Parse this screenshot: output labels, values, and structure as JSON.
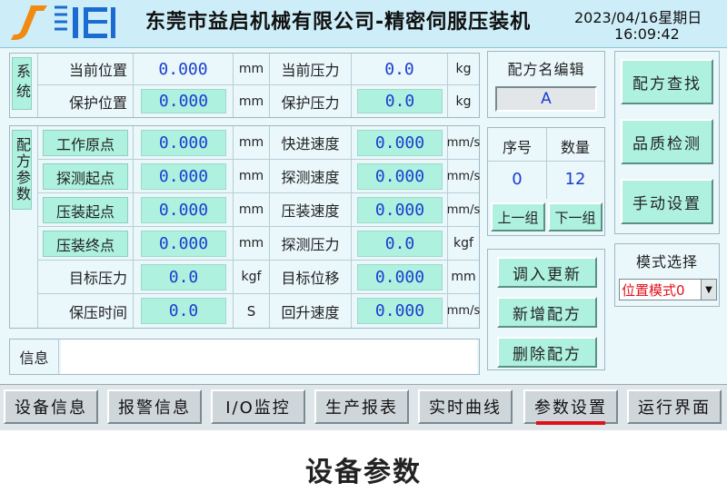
{
  "header": {
    "company": "东莞市益启机械有限公司-精密伺服压装机",
    "date": "2023/04/16星期日",
    "time": "16:09:42"
  },
  "system": {
    "label": "系统",
    "rows": [
      {
        "label": "当前位置",
        "value": "0.000",
        "unit": "mm",
        "label2": "当前压力",
        "value2": "0.0",
        "unit2": "kg"
      },
      {
        "label": "保护位置",
        "value": "0.000",
        "unit": "mm",
        "label2": "保护压力",
        "value2": "0.0",
        "unit2": "kg"
      }
    ]
  },
  "recipe": {
    "label": "配方参数",
    "rows": [
      {
        "label": "工作原点",
        "value": "0.000",
        "unit": "mm",
        "label2": "快进速度",
        "value2": "0.000",
        "unit2": "mm/s"
      },
      {
        "label": "探测起点",
        "value": "0.000",
        "unit": "mm",
        "label2": "探测速度",
        "value2": "0.000",
        "unit2": "mm/s"
      },
      {
        "label": "压装起点",
        "value": "0.000",
        "unit": "mm",
        "label2": "压装速度",
        "value2": "0.000",
        "unit2": "mm/s"
      },
      {
        "label": "压装终点",
        "value": "0.000",
        "unit": "mm",
        "label2": "探测压力",
        "value2": "0.0",
        "unit2": "kgf"
      },
      {
        "label": "目标压力",
        "value": "0.0",
        "unit": "kgf",
        "label2": "目标位移",
        "value2": "0.000",
        "unit2": "mm"
      },
      {
        "label": "保压时间",
        "value": "0.0",
        "unit": "S",
        "label2": "回升速度",
        "value2": "0.000",
        "unit2": "mm/s"
      }
    ]
  },
  "info": {
    "label": "信息",
    "value": ""
  },
  "recipe_name": {
    "title": "配方名编辑",
    "value": "A"
  },
  "group": {
    "seq_label": "序号",
    "qty_label": "数量",
    "seq_value": "0",
    "qty_value": "12",
    "prev": "上一组",
    "next": "下一组"
  },
  "actions": {
    "load": "调入更新",
    "add": "新增配方",
    "delete": "删除配方"
  },
  "side": {
    "find": "配方查找",
    "quality": "品质检测",
    "manual": "手动设置"
  },
  "mode": {
    "title": "模式选择",
    "selected": "位置模式0"
  },
  "nav": [
    "设备信息",
    "报警信息",
    "I/O监控",
    "生产报表",
    "实时曲线",
    "参数设置",
    "运行界面"
  ],
  "caption": "设备参数",
  "colors": {
    "accent": "#aef1df",
    "value_text": "#1a3ed0",
    "active_underline": "#e0101a",
    "mode_text": "#e0101a"
  }
}
